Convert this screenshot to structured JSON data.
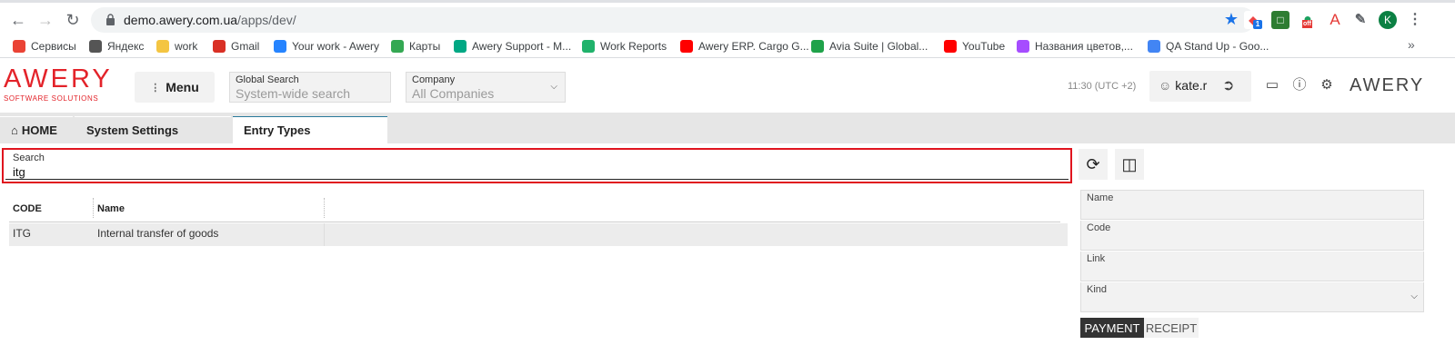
{
  "browser": {
    "url_host": "demo.awery.com.ua",
    "url_path": "/apps/dev/",
    "profile_initial": "K",
    "bookmarks": [
      {
        "label": "Сервисы",
        "color": "#ea4335"
      },
      {
        "label": "Яндекс",
        "color": "#555555"
      },
      {
        "label": "work",
        "color": "#f4c542"
      },
      {
        "label": "Gmail",
        "color": "#d93025"
      },
      {
        "label": "Your work - Awery",
        "color": "#2684ff"
      },
      {
        "label": "Карты",
        "color": "#34a853"
      },
      {
        "label": "Awery Support - M...",
        "color": "#00a884"
      },
      {
        "label": "Work Reports",
        "color": "#20b26b"
      },
      {
        "label": "Awery ERP. Cargo G...",
        "color": "#ff0000"
      },
      {
        "label": "Avia Suite | Global...",
        "color": "#1fa24a"
      },
      {
        "label": "YouTube",
        "color": "#ff0000"
      },
      {
        "label": "Названия цветов,...",
        "color": "#a64dff"
      },
      {
        "label": "QA Stand Up - Goo...",
        "color": "#4285f4"
      }
    ],
    "more_bookmarks": "»",
    "ext_badge": "1",
    "ext_off": "off"
  },
  "header": {
    "logo_text": "AWERY",
    "logo_sub": "SOFTWARE SOLUTIONS",
    "menu_label": "Menu",
    "global_search_label": "Global Search",
    "global_search_placeholder": "System-wide search",
    "company_label": "Company",
    "company_value": "All Companies",
    "time": "11:30 (UTC +2)",
    "username": "kate.r",
    "brand_right": "AWERY"
  },
  "tabs": [
    {
      "label": "HOME"
    },
    {
      "label": "System Settings"
    },
    {
      "label": "Entry Types"
    }
  ],
  "search": {
    "label": "Search",
    "value": "itg"
  },
  "table": {
    "columns": [
      "CODE",
      "Name"
    ],
    "rows": [
      {
        "code": "ITG",
        "name": "Internal transfer of goods"
      }
    ]
  },
  "form": {
    "name_label": "Name",
    "code_label": "Code",
    "link_label": "Link",
    "kind_label": "Kind",
    "segments": [
      "PAYMENT",
      "RECEIPT"
    ]
  },
  "colors": {
    "brand_red": "#e3232a",
    "highlight_border": "#e0141e",
    "active_segment": "#333333"
  }
}
